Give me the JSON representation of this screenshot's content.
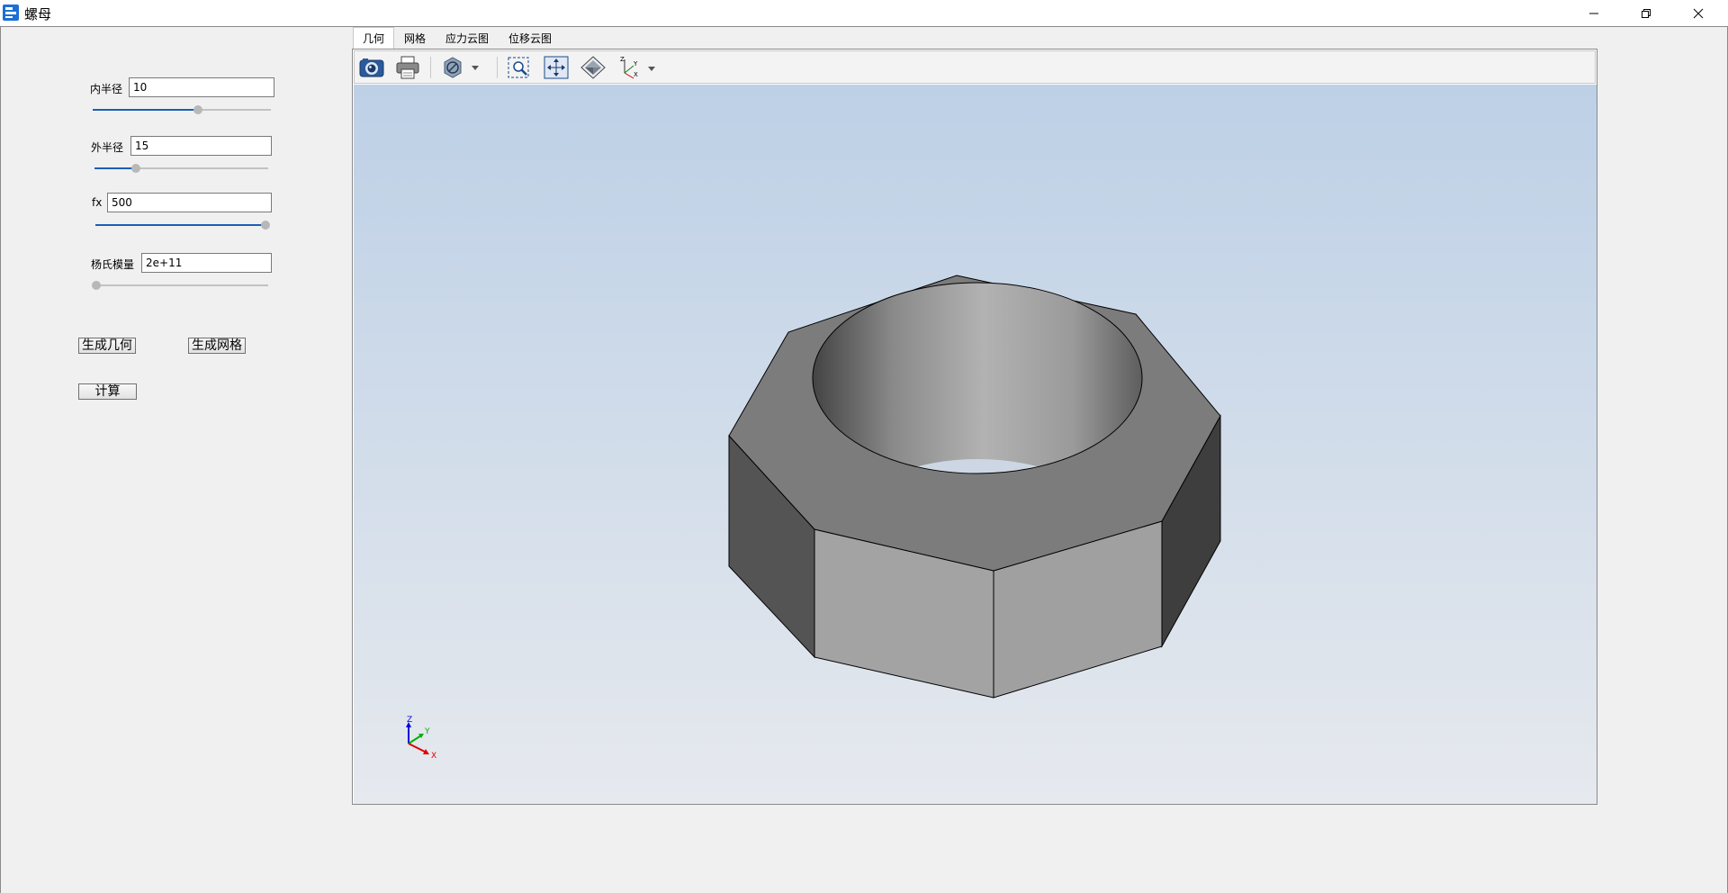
{
  "window": {
    "title": "螺母"
  },
  "params": {
    "inner_radius": {
      "label": "内半径",
      "value": "10",
      "slider_fraction": 0.59
    },
    "outer_radius": {
      "label": "外半径",
      "value": "15",
      "slider_fraction": 0.24
    },
    "fx": {
      "label": "fx",
      "value": "500",
      "slider_fraction": 1.0
    },
    "youngs_modulus": {
      "label": "杨氏模量",
      "value": "2e+11",
      "slider_fraction": 0.0
    }
  },
  "buttons": {
    "generate_geometry": "生成几何",
    "generate_mesh": "生成网格",
    "compute": "计算"
  },
  "tabs": [
    {
      "label": "几何",
      "active": true
    },
    {
      "label": "网格",
      "active": false
    },
    {
      "label": "应力云图",
      "active": false
    },
    {
      "label": "位移云图",
      "active": false
    }
  ],
  "toolbar": {
    "icons": [
      "camera-icon",
      "printer-icon",
      "display-mode-icon",
      "zoom-box-icon",
      "fit-all-icon",
      "view-iso-icon",
      "axes-icon"
    ]
  },
  "triad": {
    "x": "X",
    "y": "Y",
    "z": "Z"
  },
  "colors": {
    "accent": "#1a5fb4",
    "bg_top": "#bdd0e6",
    "bg_bottom": "#e6e9ee",
    "triad_x": "#e00000",
    "triad_y": "#00b000",
    "triad_z": "#0000e0"
  }
}
